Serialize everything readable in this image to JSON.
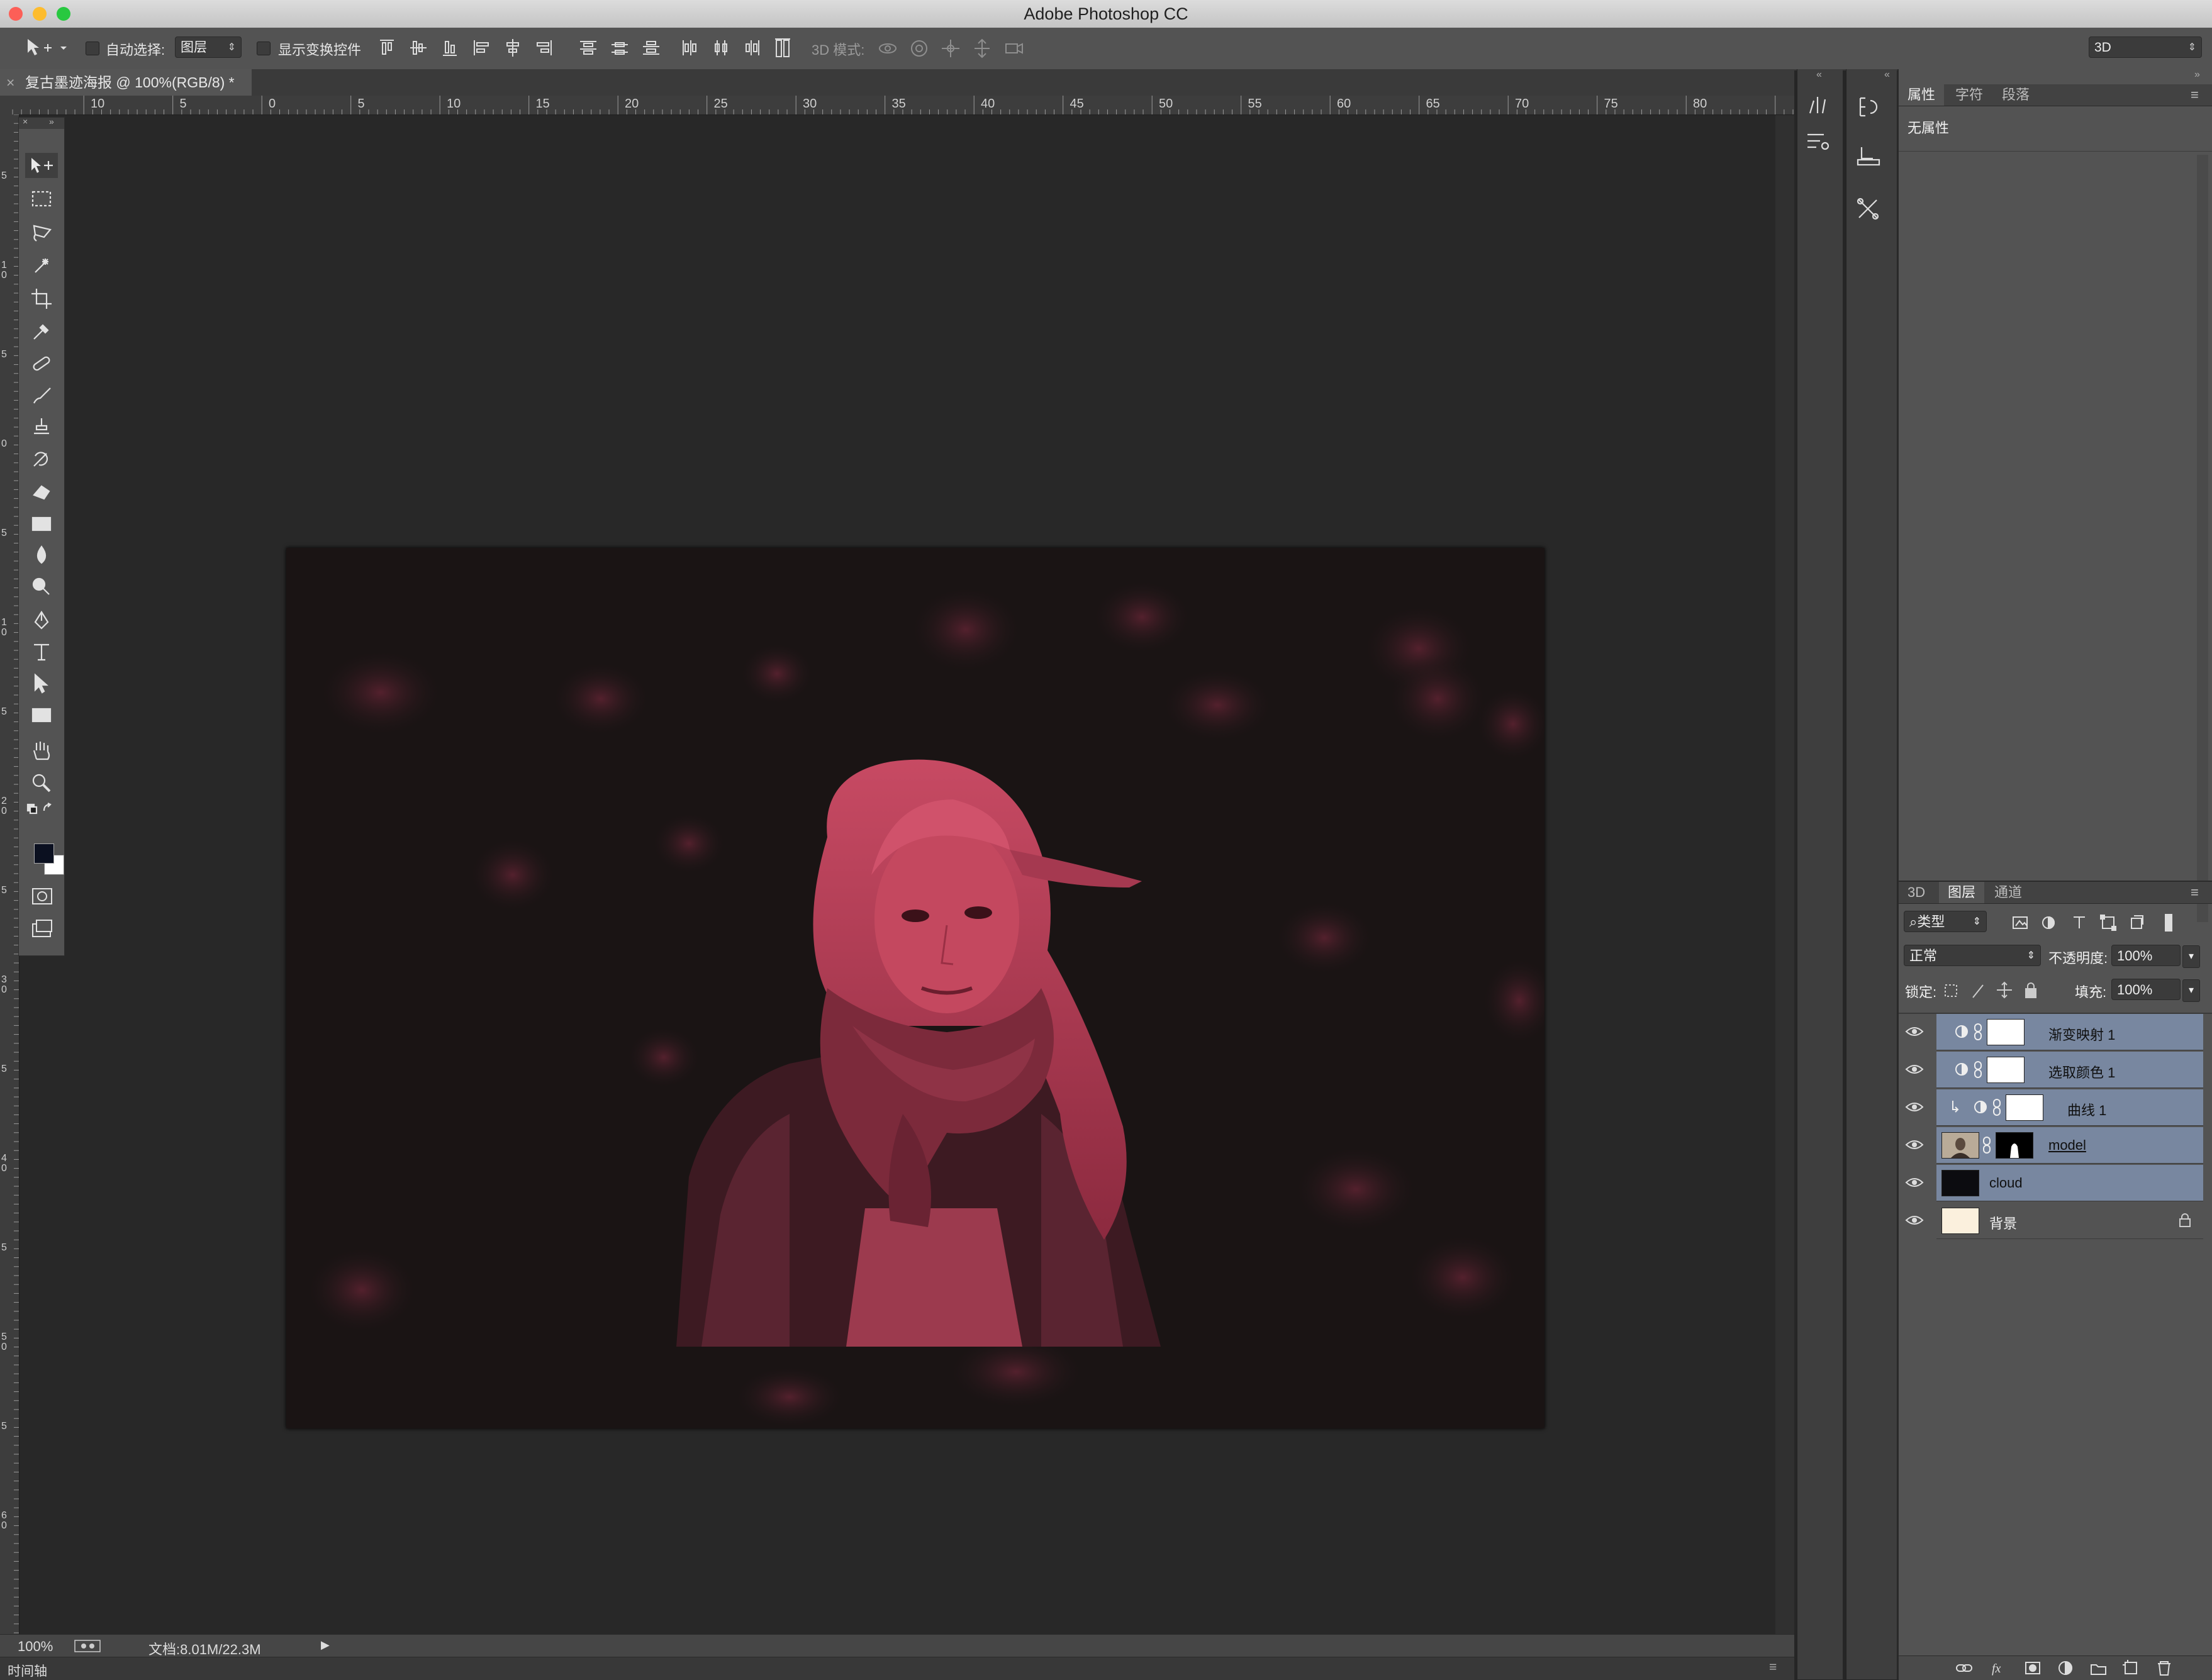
{
  "app": {
    "title": "Adobe Photoshop CC"
  },
  "optionsbar": {
    "auto_select_label": "自动选择:",
    "auto_select_target": "图层",
    "show_transform_label": "显示变换控件",
    "mode_3d_label": "3D 模式:",
    "workspace": "3D"
  },
  "document": {
    "tab_label": "复古墨迹海报 @ 100%(RGB/8) *",
    "zoom": "100%",
    "doc_info": "文档:8.01M/22.3M"
  },
  "rulers": {
    "horizontal": [
      "10",
      "5",
      "0",
      "5",
      "10",
      "15",
      "20",
      "25",
      "30",
      "35",
      "40",
      "45",
      "50",
      "55",
      "60",
      "65",
      "70",
      "75",
      "80"
    ],
    "vertical": [
      "5",
      "1 0",
      "5",
      "0",
      "5",
      "1 0",
      "5",
      "2 0",
      "5",
      "3 0",
      "5",
      "4 0",
      "5",
      "5 0",
      "5",
      "6 0"
    ]
  },
  "timeline": {
    "label": "时间轴"
  },
  "properties_panel": {
    "tabs": [
      "属性",
      "字符",
      "段落"
    ],
    "active_tab": "属性",
    "content": "无属性"
  },
  "layers_panel": {
    "tabs": [
      "3D",
      "图层",
      "通道"
    ],
    "active_tab": "图层",
    "filter_kind": "类型",
    "blend_mode": "正常",
    "opacity_label": "不透明度:",
    "opacity_value": "100%",
    "lock_label": "锁定:",
    "fill_label": "填充:",
    "fill_value": "100%",
    "layers": [
      {
        "name": "渐变映射 1",
        "type": "adjustment",
        "selected": true
      },
      {
        "name": "选取颜色 1",
        "type": "adjustment",
        "selected": true
      },
      {
        "name": "曲线 1",
        "type": "adjustment",
        "selected": true,
        "clipped": true
      },
      {
        "name": "model",
        "type": "masked-image",
        "selected": true
      },
      {
        "name": "cloud",
        "type": "image",
        "selected": true
      },
      {
        "name": "背景",
        "type": "background",
        "selected": false,
        "locked": true
      }
    ]
  },
  "colors": {
    "foreground": "#0b1020",
    "background": "#ffffff",
    "selection": "#7887a0",
    "photo_tint": "#b8364f"
  }
}
